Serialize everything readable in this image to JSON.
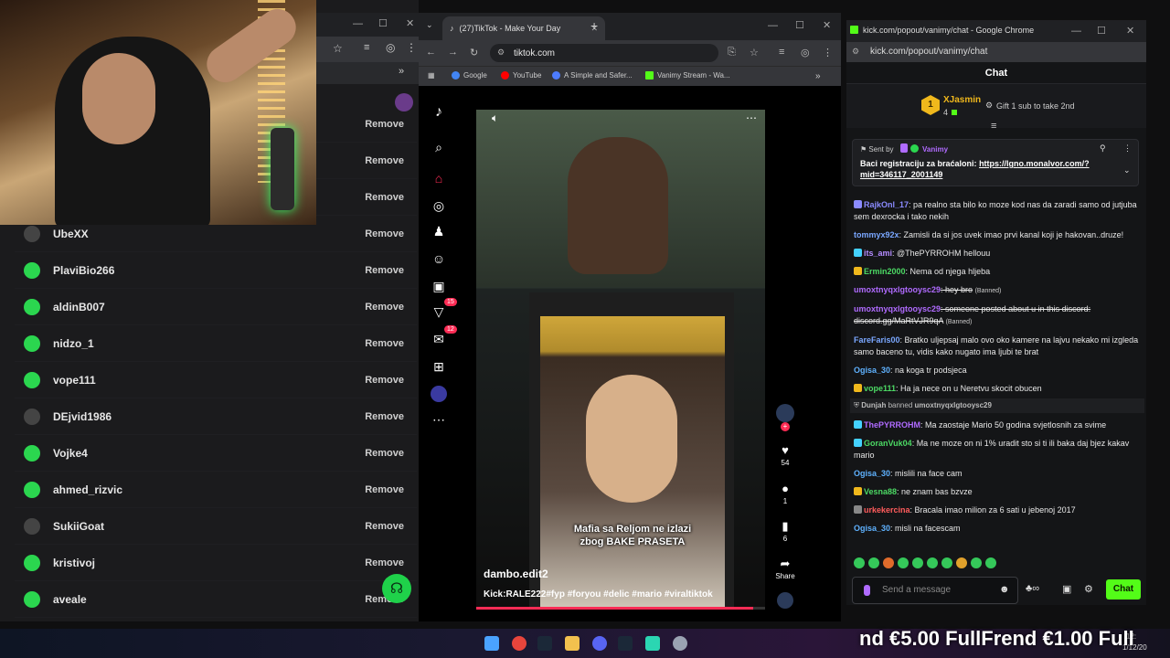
{
  "left_panel": {
    "rows": [
      {
        "name": "",
        "action": "Remove"
      },
      {
        "name": "",
        "action": "Remove"
      },
      {
        "name": "",
        "action": "Remove"
      },
      {
        "name": "UbeXX",
        "action": "Remove"
      },
      {
        "name": "PlaviBio266",
        "action": "Remove"
      },
      {
        "name": "aldinB007",
        "action": "Remove"
      },
      {
        "name": "nidzo_1",
        "action": "Remove"
      },
      {
        "name": "vope111",
        "action": "Remove"
      },
      {
        "name": "DEjvid1986",
        "action": "Remove"
      },
      {
        "name": "Vojke4",
        "action": "Remove"
      },
      {
        "name": "ahmed_rizvic",
        "action": "Remove"
      },
      {
        "name": "SukiiGoat",
        "action": "Remove"
      },
      {
        "name": "kristivoj",
        "action": "Remove"
      },
      {
        "name": "aveale",
        "action": "Remove"
      }
    ]
  },
  "tiktok": {
    "tab_title": "(27)TikTok - Make Your Day",
    "url": "tiktok.com",
    "bookmarks": [
      "Google",
      "YouTube",
      "A Simple and Safer...",
      "Vanimy Stream - Wa..."
    ],
    "badges": {
      "inbox": "15",
      "messages": "12"
    },
    "video": {
      "subtitle_line1": "Mafia sa Reljom ne izlazi",
      "subtitle_line2": "zbog BAKE PRASETA",
      "author": "dambo.edit2",
      "caption": "Kick:RALE222#fyp #foryou #delic #mario #viraltiktok",
      "progress": 0.96
    },
    "actions": {
      "likes": "54",
      "comments": "1",
      "saves": "6",
      "share_label": "Share"
    }
  },
  "chat": {
    "window_title": "kick.com/popout/vanimy/chat - Google Chrome",
    "url": "kick.com/popout/vanimy/chat",
    "header": "Chat",
    "gift": {
      "rank": "1",
      "user": "XJasmin",
      "count": "4",
      "text": "Gift 1 sub to take 2nd"
    },
    "pinned": {
      "sent_by_label": "Sent by",
      "sender": "Vanimy",
      "text": "Baci registraciju za braćaloni: ",
      "link": "https://lgno.monalvor.com/?mid=346117_2001149"
    },
    "messages": [
      {
        "user": "RajkOnl_17",
        "color": "#8b8bff",
        "text": ": pa realno sta bilo ko moze kod nas da zaradi samo od jutjuba sem dexrocka i tako nekih",
        "badge": "#8b8bff"
      },
      {
        "user": "tommyx92x",
        "color": "#7aa7ff",
        "text": ": Zamisli da si jos uvek imao prvi kanal koji je hakovan..druze!"
      },
      {
        "user": "its_ami",
        "color": "#b48cff",
        "text": ": @ThePYRROHM hellouu",
        "badge": "#44d1ff"
      },
      {
        "user": "Ermin2000",
        "color": "#4cd964",
        "text": ": Nema od njega hljeba",
        "badge": "#f0b81c"
      },
      {
        "user": "umoxtnyqxlgtooysc29",
        "color": "#b06bff",
        "text": ": hey bro",
        "banned": "(Banned)",
        "strike": true
      },
      {
        "user": "umoxtnyqxlgtooysc29",
        "color": "#b06bff",
        "text": ": someone posted about u in this discord: discord.gg/MaRtVJR9qA",
        "banned": "(Banned)",
        "strike": true
      },
      {
        "user": "FareFaris00",
        "color": "#7aa7ff",
        "text": ": Bratko uljepsaj malo ovo oko kamere na lajvu nekako mi izgleda samo baceno tu, vidis kako nugato ima ljubi te brat"
      },
      {
        "user": "Ogisa_30",
        "color": "#5fb2ff",
        "text": ": na koga tr podsjeca"
      },
      {
        "user": "vope111",
        "color": "#4cd964",
        "text": ": Ha ja nece on u Neretvu skocit obucen",
        "badge": "#f0b81c"
      },
      {
        "system": true,
        "user": "Dunjah",
        "text": " banned ",
        "target": "umoxtnyqxlgtooysc29"
      },
      {
        "user": "ThePYRROHM",
        "color": "#b06bff",
        "text": ": Ma zaostaje Mario 50 godina svjetlosnih za svime",
        "badge": "#44d1ff"
      },
      {
        "user": "GoranVuk04",
        "color": "#4cd964",
        "text": ": Ma ne moze on ni 1% uradit sto si ti ili baka daj bjez kakav mario",
        "badge": "#44d1ff"
      },
      {
        "user": "Ogisa_30",
        "color": "#5fb2ff",
        "text": ": mislili na face cam"
      },
      {
        "user": "Vesna88",
        "color": "#4cd964",
        "text": ": ne znam bas bzvze",
        "badge": "#f0b81c"
      },
      {
        "user": "urkekercina",
        "color": "#ff5c5c",
        "text": ": Bracala imao milion za 6 sati u jebenoj 2017",
        "badge": "#888"
      },
      {
        "user": "Ogisa_30",
        "color": "#5fb2ff",
        "text": ": misli na facescam"
      }
    ],
    "input_placeholder": "Send a message",
    "send_label": "Chat"
  },
  "overlay": {
    "ticker": "nd €5.00 FullFrend €1.00 Full"
  },
  "clock": {
    "time": "12:",
    "date": "1/12/20"
  }
}
